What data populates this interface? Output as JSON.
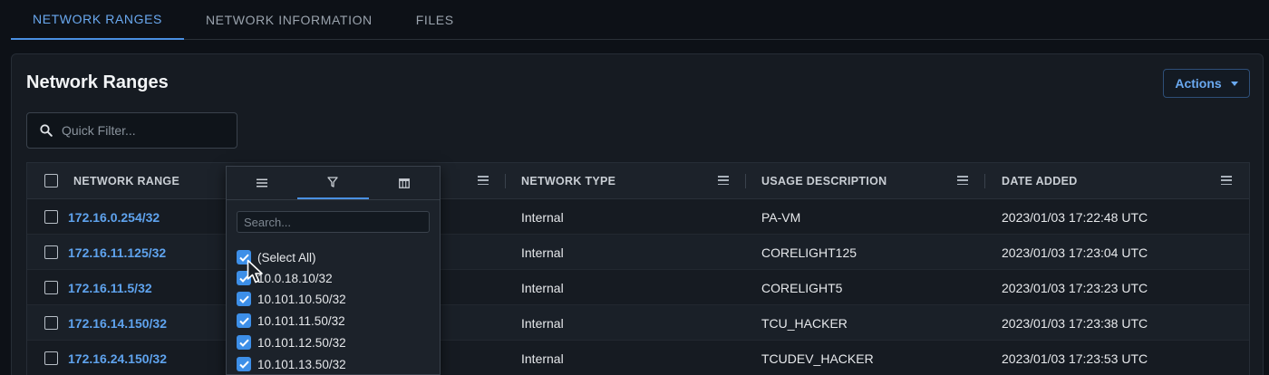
{
  "tabs": [
    {
      "label": "NETWORK RANGES",
      "active": true
    },
    {
      "label": "NETWORK INFORMATION",
      "active": false
    },
    {
      "label": "FILES",
      "active": false
    }
  ],
  "panel": {
    "title": "Network Ranges",
    "actions_label": "Actions",
    "quick_filter_placeholder": "Quick Filter..."
  },
  "grid": {
    "headers": {
      "network_range": "NETWORK RANGE",
      "network_type": "NETWORK TYPE",
      "usage_description": "USAGE DESCRIPTION",
      "date_added": "DATE ADDED"
    },
    "rows": [
      {
        "range": "172.16.0.254/32",
        "type": "Internal",
        "usage": "PA-VM",
        "date": "2023/01/03 17:22:48 UTC"
      },
      {
        "range": "172.16.11.125/32",
        "type": "Internal",
        "usage": "CORELIGHT125",
        "date": "2023/01/03 17:23:04 UTC"
      },
      {
        "range": "172.16.11.5/32",
        "type": "Internal",
        "usage": "CORELIGHT5",
        "date": "2023/01/03 17:23:23 UTC"
      },
      {
        "range": "172.16.14.150/32",
        "type": "Internal",
        "usage": "TCU_HACKER",
        "date": "2023/01/03 17:23:38 UTC"
      },
      {
        "range": "172.16.24.150/32",
        "type": "Internal",
        "usage": "TCUDEV_HACKER",
        "date": "2023/01/03 17:23:53 UTC"
      }
    ]
  },
  "column_menu": {
    "search_placeholder": "Search...",
    "items": [
      "(Select All)",
      "10.0.18.10/32",
      "10.101.10.50/32",
      "10.101.11.50/32",
      "10.101.12.50/32",
      "10.101.13.50/32"
    ]
  },
  "colors": {
    "accent": "#4a90e2",
    "link": "#5fa3ee",
    "checkbox_checked": "#3d8fe8",
    "background": "#0d1117",
    "panel": "#161b22"
  },
  "icons": {
    "quick_filter": "search-icon",
    "column_menu_tab_general": "menu-icon",
    "column_menu_tab_filter": "filter-icon",
    "column_menu_tab_columns": "columns-icon",
    "actions": "caret-down-icon"
  }
}
